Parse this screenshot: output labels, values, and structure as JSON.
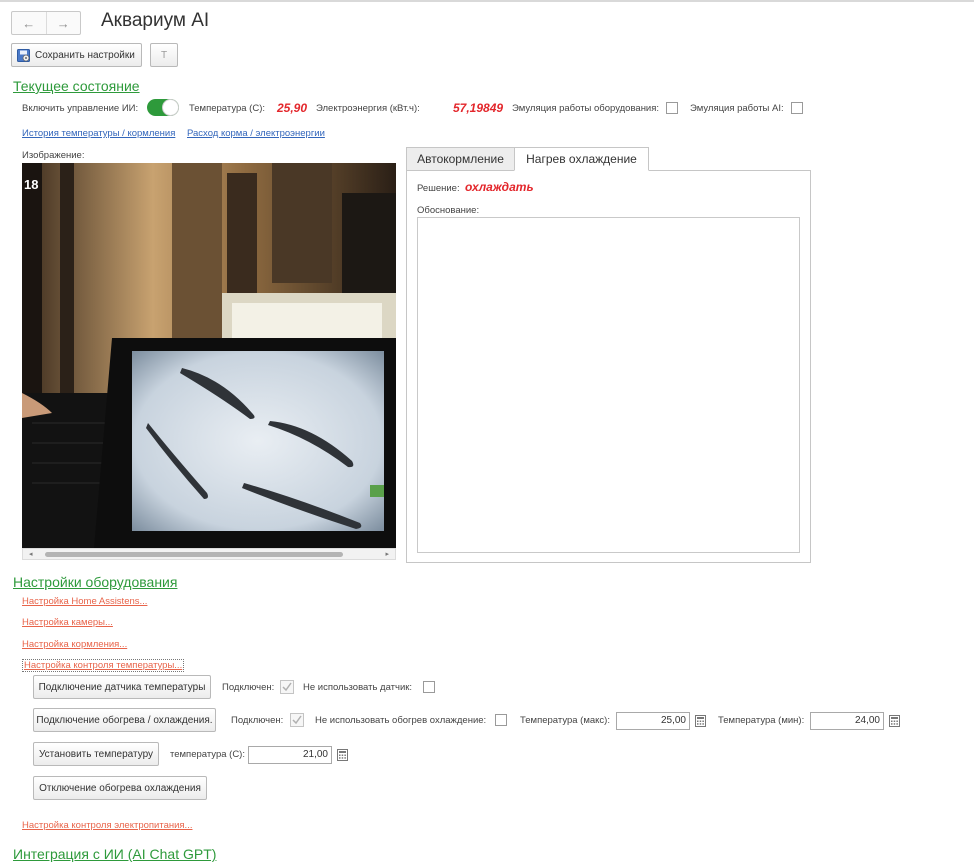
{
  "window": {
    "title": "Аквариум AI",
    "back": "←",
    "forward": "→"
  },
  "toolbar": {
    "save_label": "Сохранить настройки",
    "t_label": "T"
  },
  "status": {
    "section_title": "Текущее состояние",
    "ai_control_label": "Включить управление ИИ:",
    "ai_control_on": true,
    "temperature_label": "Температура (С):",
    "temperature_value": "25,90",
    "energy_label": "Электроэнергия (кВт.ч):",
    "energy_value": "57,19849",
    "emulation_equipment_label": "Эмуляция работы оборудования:",
    "emulation_ai_label": "Эмуляция работы AI:",
    "link_temp_history": "История температуры / кормления",
    "link_feed_energy": "Расход корма / электроэнергии",
    "image_label": "Изображение:",
    "image_overlay": "18"
  },
  "tabs": {
    "items": [
      {
        "label": "Автокормление",
        "active": false
      },
      {
        "label": "Нагрев охлаждение",
        "active": true
      }
    ],
    "decision_label": "Решение:",
    "decision_value": "охлаждать",
    "reasoning_label": "Обоснование:",
    "reasoning_text": ""
  },
  "equipment": {
    "section_title": "Настройки оборудования",
    "link_home_assistant": "Настройка Home Assistens...",
    "link_camera": "Настройка камеры...",
    "link_feeding": "Настройка кормления...",
    "link_temp_control": "Настройка контроля температуры...",
    "btn_connect_sensor": "Подключение датчика температуры",
    "connected_label_1": "Подключен:",
    "dont_use_sensor_label": "Не использовать датчик:",
    "btn_connect_heating": "Подключение обогрева / охлаждения.",
    "connected_label_2": "Подключен:",
    "dont_use_heating_label": "Не использовать обогрев охлаждение:",
    "temp_max_label": "Температура (макс):",
    "temp_max_value": "25,00",
    "temp_min_label": "Температура (мин):",
    "temp_min_value": "24,00",
    "btn_set_temp": "Установить температуру",
    "set_temp_label": "температура (С):",
    "set_temp_value": "21,00",
    "btn_disable_heating": "Отключение обогрева охлаждения",
    "link_power_control": "Настройка контроля электропитания..."
  },
  "integration": {
    "section_title": "Интеграция с ИИ (AI Chat GPT)"
  },
  "colors": {
    "accent_green": "#2e9a3b",
    "value_red": "#e3262b",
    "link_blue": "#3366bb",
    "link_orange": "#e8644a"
  }
}
